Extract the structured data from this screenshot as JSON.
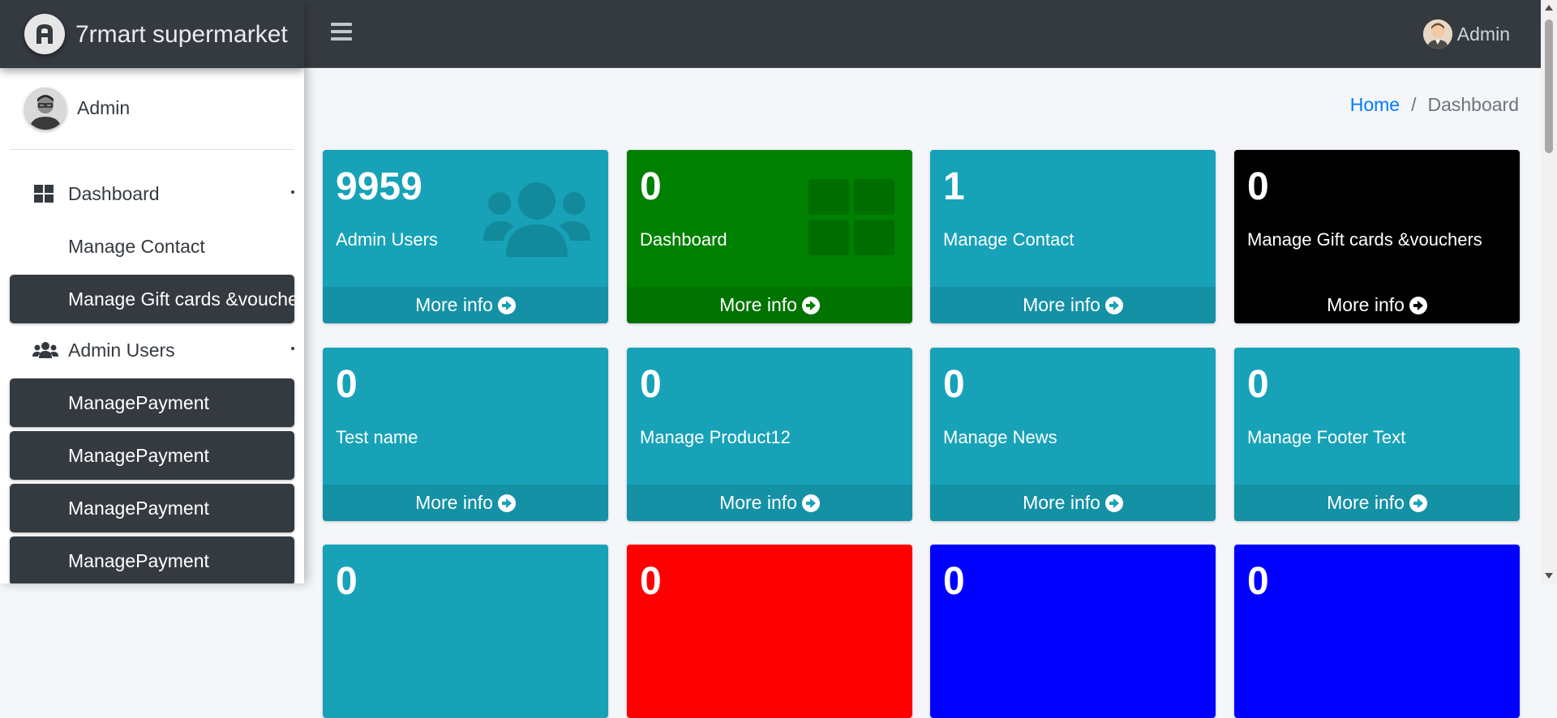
{
  "brand": {
    "name": "7rmart supermarket",
    "icon": "brand-logo-icon"
  },
  "header": {
    "user_name": "Admin"
  },
  "sidebar": {
    "user_name": "Admin",
    "items": [
      {
        "label": "Dashboard",
        "icon": "dashboard-icon",
        "active": false
      },
      {
        "label": "Manage Contact",
        "icon": "",
        "active": false
      },
      {
        "label": "Manage Gift cards &vouchers",
        "icon": "",
        "active": true
      },
      {
        "label": "Admin Users",
        "icon": "users-icon",
        "active": false
      },
      {
        "label": "ManagePayment",
        "icon": "",
        "active": true
      },
      {
        "label": "ManagePayment",
        "icon": "",
        "active": true
      },
      {
        "label": "ManagePayment",
        "icon": "",
        "active": true
      },
      {
        "label": "ManagePayment",
        "icon": "",
        "active": true
      }
    ]
  },
  "breadcrumb": {
    "home": "Home",
    "separator": "/",
    "current": "Dashboard"
  },
  "boxes": [
    {
      "value": "9959",
      "label": "Admin Users",
      "more": "More info",
      "color": "#17a2b8"
    },
    {
      "value": "0",
      "label": "Dashboard",
      "more": "More info",
      "color": "#008000"
    },
    {
      "value": "1",
      "label": "Manage Contact",
      "more": "More info",
      "color": "#17a2b8"
    },
    {
      "value": "0",
      "label": "Manage Gift cards &vouchers",
      "more": "More info",
      "color": "#000000"
    },
    {
      "value": "0",
      "label": "Test name",
      "more": "More info",
      "color": "#17a2b8"
    },
    {
      "value": "0",
      "label": "Manage Product12",
      "more": "More info",
      "color": "#17a2b8"
    },
    {
      "value": "0",
      "label": "Manage News",
      "more": "More info",
      "color": "#17a2b8"
    },
    {
      "value": "0",
      "label": "Manage Footer Text",
      "more": "More info",
      "color": "#17a2b8"
    },
    {
      "value": "0",
      "color": "#17a2b8"
    },
    {
      "value": "0",
      "color": "#ff0000"
    },
    {
      "value": "0",
      "color": "#0000ff"
    },
    {
      "value": "0",
      "color": "#0000ff"
    }
  ]
}
